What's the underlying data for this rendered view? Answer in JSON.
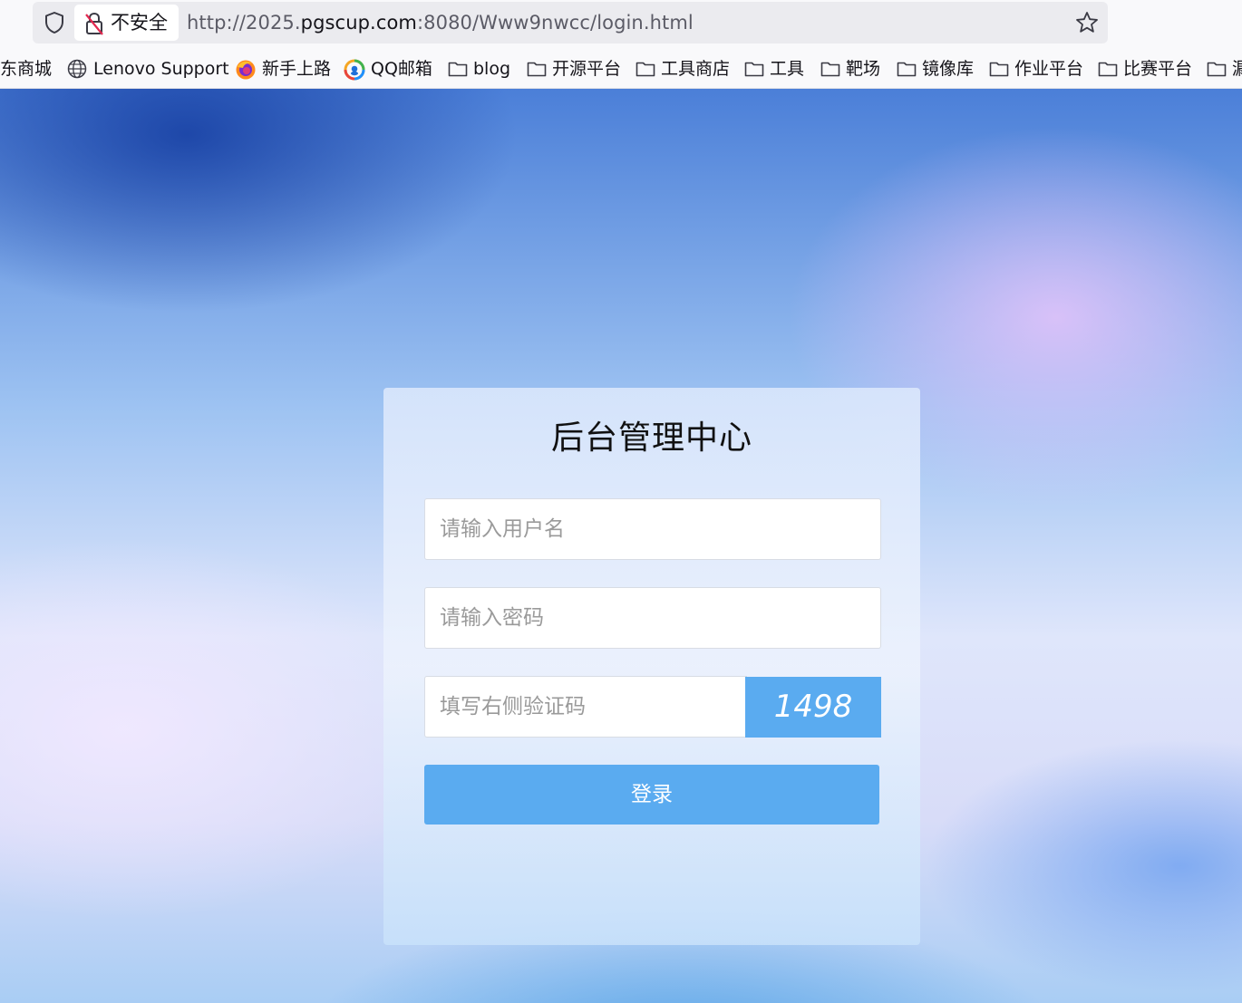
{
  "browser": {
    "security_label": "不安全",
    "url_prefix": "http://2025.",
    "url_host": "pgscup.com",
    "url_suffix": ":8080/Www9nwcc/login.html"
  },
  "bookmarks": [
    {
      "label": "东商城",
      "icon": "none"
    },
    {
      "label": "Lenovo Support",
      "icon": "globe-icon"
    },
    {
      "label": "新手上路",
      "icon": "firefox-icon"
    },
    {
      "label": "QQ邮箱",
      "icon": "qqmail-icon"
    },
    {
      "label": "blog",
      "icon": "folder-icon"
    },
    {
      "label": "开源平台",
      "icon": "folder-icon"
    },
    {
      "label": "工具商店",
      "icon": "folder-icon"
    },
    {
      "label": "工具",
      "icon": "folder-icon"
    },
    {
      "label": "靶场",
      "icon": "folder-icon"
    },
    {
      "label": "镜像库",
      "icon": "folder-icon"
    },
    {
      "label": "作业平台",
      "icon": "folder-icon"
    },
    {
      "label": "比赛平台",
      "icon": "folder-icon"
    },
    {
      "label": "漏",
      "icon": "folder-icon"
    }
  ],
  "login": {
    "title": "后台管理中心",
    "username_placeholder": "请输入用户名",
    "password_placeholder": "请输入密码",
    "captcha_placeholder": "填写右侧验证码",
    "captcha_code": "1498",
    "submit_label": "登录"
  },
  "colors": {
    "accent": "#5aabf0"
  }
}
